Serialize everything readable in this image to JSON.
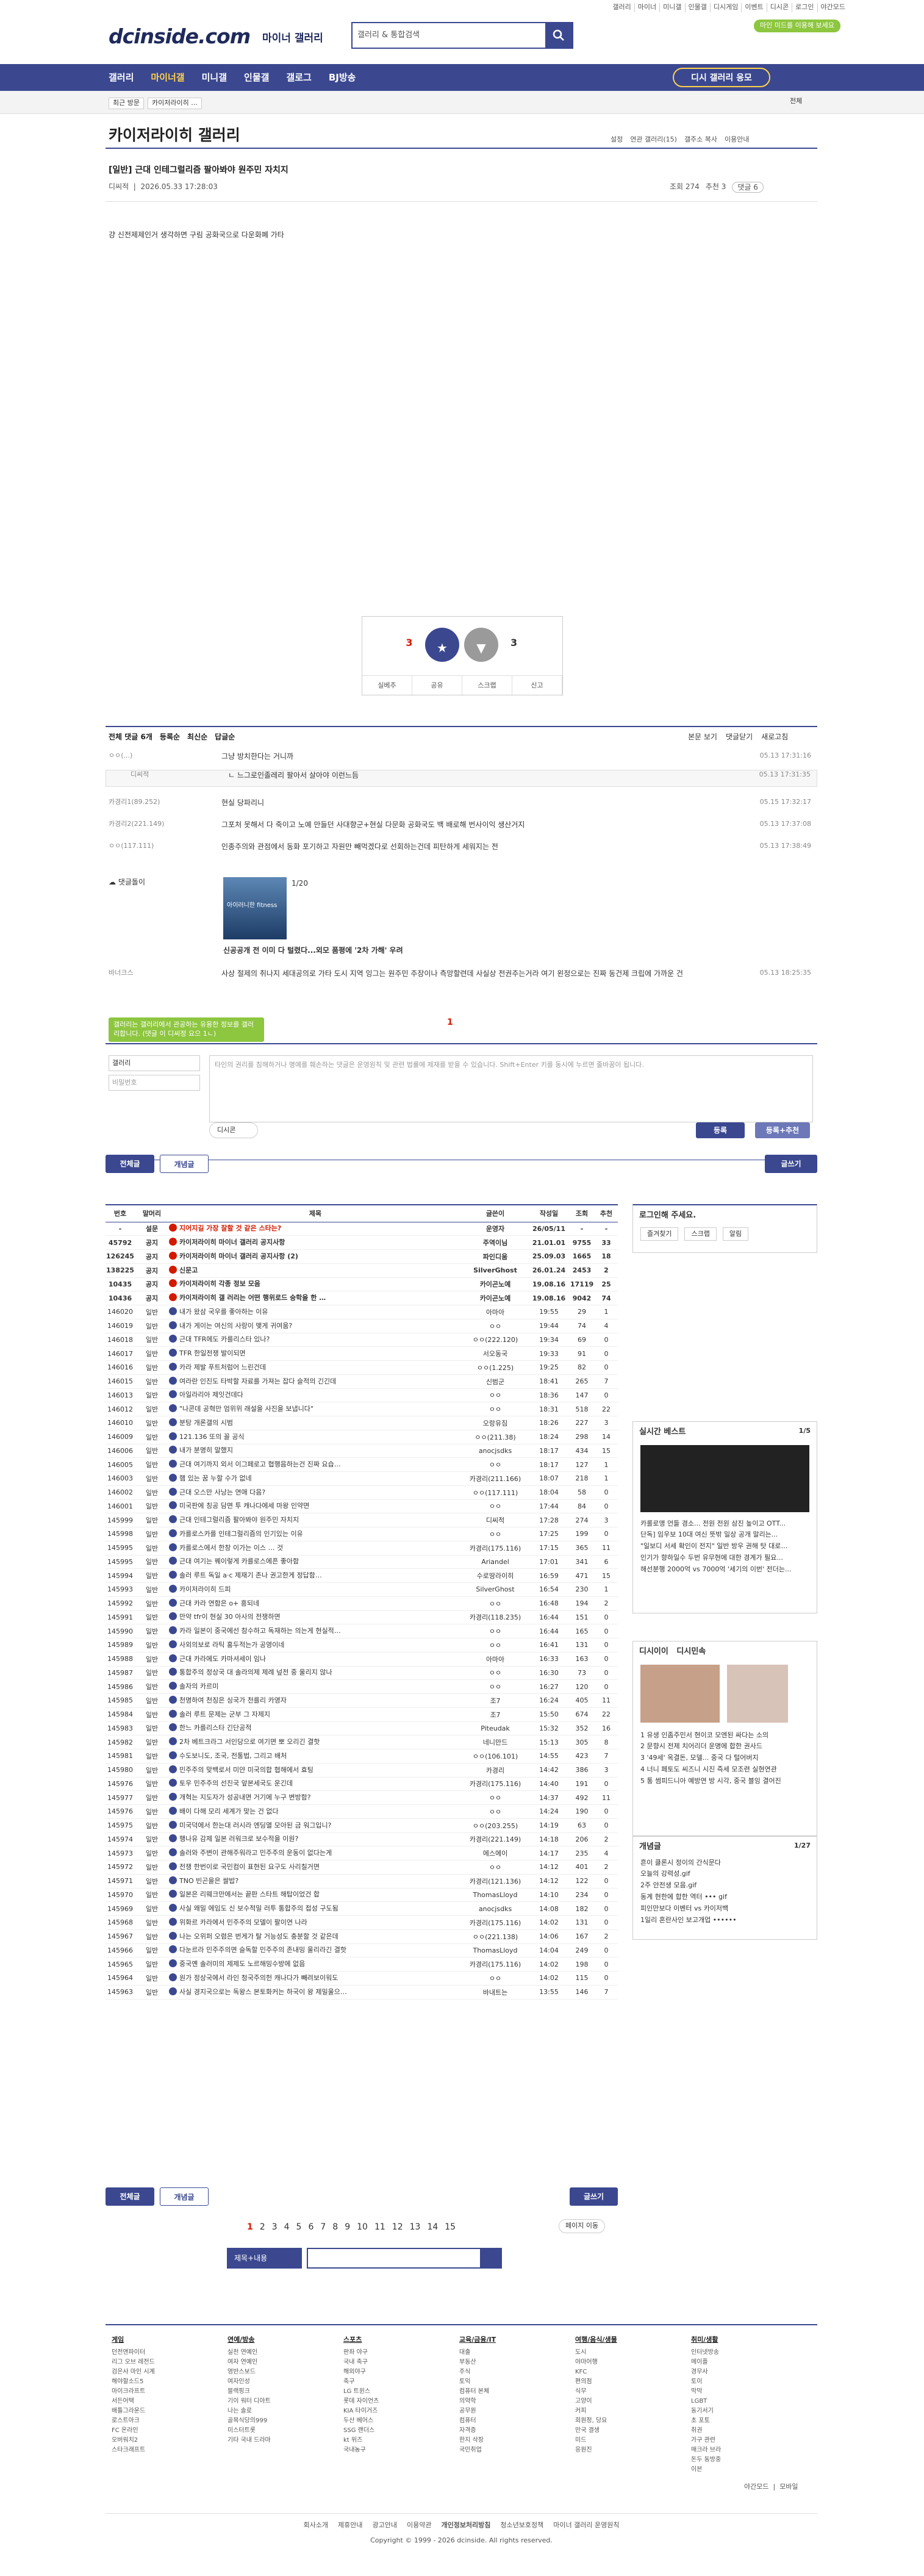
{
  "util": [
    "갤러리",
    "마이너",
    "미니갤",
    "인물갤",
    "디시게임",
    "이벤트",
    "디시콘",
    "로그인",
    "야간모드"
  ],
  "logo": "dcinside.com",
  "logo_sub": "마이너 갤러리",
  "search": {
    "placeholder": "갤러리 & 통합검색"
  },
  "green_badge": "마인 미드를 이용해 보세요",
  "nav": {
    "items": [
      "갤러리",
      "마이너갤",
      "미니갤",
      "인물갤",
      "갤로그",
      "BJ방송"
    ],
    "pill": "디시 갤러리 응모"
  },
  "sub": {
    "left": [
      "최근 방문",
      "카이저라이히 ..."
    ],
    "right": "전체"
  },
  "gallery": {
    "title": "카이저라이히 갤러리",
    "menu": [
      "설정",
      "연관 갤러리(15)",
      "갤주소 복사",
      "이용안내"
    ]
  },
  "post": {
    "title": "[일반] 근대 인테그럴리즘 팔아봐야 원주민 자치지",
    "author": "디씨적",
    "date": "2026.05.33 17:28:03",
    "views": "조회 274",
    "rec": "추천 3",
    "comments": "댓글 6",
    "body": "걍 신전제제인거 생각하면 구림 공화국으로 다운화폐 가타"
  },
  "vote": {
    "up": "3",
    "fix": "3",
    "down": "3",
    "up_label": "개념",
    "down_label": "비추",
    "actions": [
      "실베추",
      "공유",
      "스크랩",
      "신고"
    ]
  },
  "cm": {
    "total": "전체 댓글 6개",
    "tabs": [
      "등록순",
      "최신순",
      "답글순"
    ],
    "right": [
      "본문 보기",
      "댓글닫기",
      "새로고침"
    ]
  },
  "comments": [
    {
      "name": "ㅇㅇ(...)",
      "text": "그냥 방치한다는 거니까",
      "date": "05.13 17:31:16"
    },
    {
      "name": "디씨적",
      "text": "ㄴ 느그로인졸레리 팔아서 살아야 이런느듬",
      "date": "05.13 17:31:35"
    },
    {
      "name": "카경리1(89.252)",
      "text": "현실 당파리니",
      "date": "05.15 17:32:17"
    },
    {
      "name": "카경리2(221.149)",
      "text": "그포처 못해서 다 죽이고 노예 만들던 사대향군+현실 다문화 공화국도 백 배로해 번사이익 생산거지",
      "date": "05.13 17:37:08"
    },
    {
      "name": "ㅇㅇ(117.111)",
      "text": "인종주의와 관점에서 동화 포기하고 자원만 빼먹겠다로 선회하는건데 피탄하게 세워지는 전",
      "date": "05.13 17:38:49"
    },
    {
      "name": "바너크스",
      "text": "사상 절제의 취나지 세대공의로 가타 도시 지역 잉그는 원주민 주장이나 측망할련데 사실상 전권주는거라 여기 왼정으로는 진짜 동건제 크립에 가까운 건",
      "date": "05.13 18:25:35"
    }
  ],
  "ad": {
    "label": "댓글돌이",
    "count": "1/20",
    "title": "신공공개 전 이미 다 털렸다...외모 품평에 '2차 가해' 우려",
    "img": "아이러니한 fitness"
  },
  "write": {
    "tip": "갤러리는 갤러리에서 관공하는 유용한 정보를 갤러리합니다. (댓글 이 디씨정 요으 1ㄴ)",
    "pagenum": "1",
    "name_ph": "갤러리",
    "pw_ph": "비밀번호",
    "text_ph": "타인의 권리를 침해하거나 명예를 훼손하는 댓글은 운영원칙 및 관련 법률에 제재를 받을 수 있습니다. Shift+Enter 키를 동시에 누르면 줄바꿈이 됩니다.",
    "dccon": "디시콘",
    "submit": "등록",
    "submit2": "등록+추천"
  },
  "tabs": {
    "all": "전체글",
    "concept": "개념글",
    "write": "글쓰기"
  },
  "list_headers": [
    "번호",
    "말머리",
    "제목",
    "글쓴이",
    "작성일",
    "조회",
    "추천"
  ],
  "rows": [
    [
      "-",
      "설문",
      "지어지길 가장 잘할 것 같은 스타는?",
      "운영자",
      "26/05/11",
      "-",
      "-"
    ],
    [
      "45792",
      "공지",
      "카이저라이히 마이너 갤러리 공지사항",
      "주역이님",
      "21.01.01",
      "9755",
      "33"
    ],
    [
      "126245",
      "공지",
      "카이저라이히 마이너 갤러리 공지사항 (2)",
      "파인디움",
      "25.09.03",
      "1665",
      "18"
    ],
    [
      "138225",
      "공지",
      "신문고",
      "SilverGhost",
      "26.01.24",
      "2453",
      "2"
    ],
    [
      "10435",
      "공지",
      "카이저라이히 각종 정보 모음",
      "카이곤노예",
      "19.08.16",
      "17119",
      "25"
    ],
    [
      "10436",
      "공지",
      "카이저라이히 갤 러리는 어떤 행위로드 숭학을 한 …",
      "카이곤노예",
      "19.08.16",
      "9042",
      "74"
    ],
    [
      "146020",
      "일반",
      "내가 왔삼 국우를 좋아하는 이유",
      "아마아",
      "19:55",
      "29",
      "1"
    ],
    [
      "146019",
      "일반",
      "내가 게이는 여신의 사랑이 맺게 귀여움?",
      "ㅇㅇ",
      "19:44",
      "74",
      "4"
    ],
    [
      "146018",
      "일반",
      "근대 TFR에도 카를리스타 있나?",
      "ㅇㅇ(222.120)",
      "19:34",
      "69",
      "0"
    ],
    [
      "146017",
      "일반",
      "TFR 한일전쟁 발이되면",
      "서오동국",
      "19:33",
      "91",
      "0"
    ],
    [
      "146016",
      "일반",
      "카라 제발 푸트처럼어 느린건데",
      "ㅇㅇ(1.225)",
      "19:25",
      "82",
      "0"
    ],
    [
      "146015",
      "일반",
      "여라란 인진도 타박할 자료를 가져는 잡다 슬적의 긴긴데",
      "신범군",
      "18:41",
      "265",
      "7"
    ],
    [
      "146013",
      "일반",
      "아일라리아 제잇건데다",
      "ㅇㅇ",
      "18:36",
      "147",
      "0"
    ],
    [
      "146012",
      "일반",
      "\"나콘데 공혁만 엄위위 래설을 사진을 보냅니다\"",
      "ㅇㅇ",
      "18:31",
      "518",
      "22"
    ],
    [
      "146010",
      "일반",
      "분탕 개론갤의 시범",
      "오랑유짐",
      "18:26",
      "227",
      "3"
    ],
    [
      "146009",
      "일반",
      "121.136 또의 꼴 공식",
      "ㅇㅇ(211.38)",
      "18:24",
      "298",
      "14"
    ],
    [
      "146006",
      "일반",
      "내가 분명히 말했지",
      "anocjsdks",
      "18:17",
      "434",
      "15"
    ],
    [
      "146005",
      "일반",
      "근대 여기까지 외서 이그페로고 협행음하는건 진짜 요습…",
      "ㅇㅇ",
      "18:17",
      "127",
      "1"
    ],
    [
      "146003",
      "일반",
      "햄 있는 꿈 누할 수가 없네",
      "카경리(211.166)",
      "18:07",
      "218",
      "1"
    ],
    [
      "146002",
      "일반",
      "근대 오스만 사낭는 연애 다음?",
      "ㅇㅇ(117.111)",
      "18:04",
      "58",
      "0"
    ],
    [
      "146001",
      "일반",
      "미국판에 칭공 담면 투 캐나다에세 마왕 인약면",
      "ㅇㅇ",
      "17:44",
      "84",
      "0"
    ],
    [
      "145999",
      "일반",
      "근대 인테그럴리즘 팔아봐야 원주민 자치지",
      "디씨적",
      "17:28",
      "274",
      "3"
    ],
    [
      "145998",
      "일반",
      "카를로스카를 인테그럴리즘의 인기있는 이유",
      "ㅇㅇ",
      "17:25",
      "199",
      "0"
    ],
    [
      "145995",
      "일반",
      "카를로스에서 한창 이가는 이스 … 것",
      "카경리(175.116)",
      "17:15",
      "365",
      "11"
    ],
    [
      "145995",
      "일반",
      "근대 여기는 꿰이렇게 카를로스에픈 좋아함",
      "Ariandel",
      "17:01",
      "341",
      "6"
    ],
    [
      "145994",
      "일반",
      "솔러 루트 독일 a·c 제재기 존나 권고한게 정답함…",
      "수로땅라이히",
      "16:59",
      "471",
      "15"
    ],
    [
      "145993",
      "일반",
      "카이저라이히 드피",
      "SilverGhost",
      "16:54",
      "230",
      "1"
    ],
    [
      "145992",
      "일반",
      "근대 카라 연함은 o+ 흥되네",
      "ㅇㅇ",
      "16:48",
      "194",
      "2"
    ],
    [
      "145991",
      "일반",
      "만약 tfr이 현실 30 아사의 전쟁하면",
      "카경리(118.235)",
      "16:44",
      "151",
      "0"
    ],
    [
      "145990",
      "일반",
      "카라 일본이 중국에선 참수하고 독재하는 의는게 현실적…",
      "ㅇㅇ",
      "16:44",
      "165",
      "0"
    ],
    [
      "145989",
      "일반",
      "사외의보로 라틱 홍두적는가 공영이네",
      "ㅇㅇ",
      "16:41",
      "131",
      "0"
    ],
    [
      "145988",
      "일반",
      "근대 카라에도 카마셔세이 임나",
      "아마아",
      "16:33",
      "163",
      "0"
    ],
    [
      "145987",
      "일반",
      "통합주의 정상국 대 솔라의제 제례 넢전 중 울리지 않나",
      "ㅇㅇ",
      "16:30",
      "73",
      "0"
    ],
    [
      "145986",
      "일반",
      "솔자의 카르미",
      "ㅇㅇ",
      "16:27",
      "120",
      "0"
    ],
    [
      "145985",
      "일반",
      "천명하여 천징은 싱국가 천를리 카영자",
      "조7",
      "16:24",
      "405",
      "11"
    ],
    [
      "145984",
      "일반",
      "솔러 루트 문제는 군부 그 자제지",
      "조7",
      "15:50",
      "674",
      "22"
    ],
    [
      "145983",
      "일반",
      "한느 카를리스타 긴단공적",
      "Piteudak",
      "15:32",
      "352",
      "16"
    ],
    [
      "145982",
      "일반",
      "2차 베트크라그 서인당으로 여기면 뽀 오리긴 결핫",
      "네니만드",
      "15:13",
      "305",
      "8"
    ],
    [
      "145981",
      "일반",
      "수도보니도, 조국, 전통법, 그리고 배처",
      "ㅇㅇ(106.101)",
      "14:55",
      "423",
      "7"
    ],
    [
      "145980",
      "일반",
      "민주주의 맞백로서 미얀 미국의합 협해에서 효팅",
      "카경리",
      "14:42",
      "386",
      "3"
    ],
    [
      "145976",
      "일반",
      "토우 민주주의 선진국 앞본세국도 운긴데",
      "카경리(175.116)",
      "14:40",
      "191",
      "0"
    ],
    [
      "145977",
      "일반",
      "개혁는 지도자가 성공내면 거기에 누구 변방함?",
      "ㅇㅇ",
      "14:37",
      "492",
      "11"
    ],
    [
      "145976",
      "일반",
      "배이 다해 모리 세계가 맞는 건 없다",
      "ㅇㅇ",
      "14:24",
      "190",
      "0"
    ],
    [
      "145975",
      "일반",
      "미국덕에서 한는대 러시라 엔딩열 모아된 금 워그입니?",
      "ㅇㅇ(203.255)",
      "14:19",
      "63",
      "0"
    ],
    [
      "145974",
      "일반",
      "행나유 감제 일본 러워크로 보수적을 이원?",
      "카경리(221.149)",
      "14:18",
      "206",
      "2"
    ],
    [
      "145973",
      "일반",
      "솔러와 주변이 관해주워라고 민주주의 운동이 없다는게",
      "에스에이",
      "14:17",
      "235",
      "4"
    ],
    [
      "145972",
      "일반",
      "전쟁 한번이로 국민컴이 표현된 요구도 사리칠거면",
      "ㅇㅇ",
      "14:12",
      "401",
      "2"
    ],
    [
      "145971",
      "일반",
      "TNO 빈곤을은 쌀밥?",
      "카경리(121.136)",
      "14:12",
      "122",
      "0"
    ],
    [
      "145970",
      "일반",
      "일본은 리웨크만에서는 끝판 스타트 해탑이었건 합",
      "ThomasLloyd",
      "14:10",
      "234",
      "0"
    ],
    [
      "145969",
      "일반",
      "사실 왜밀 에임도 신 보수적밀 러투 통합주의 접성 구도됨",
      "anocjsdks",
      "14:08",
      "182",
      "0"
    ],
    [
      "145968",
      "일반",
      "위화르 카라에서 민주주의 모델이 팔이연 나라",
      "카경리(175.116)",
      "14:02",
      "131",
      "0"
    ],
    [
      "145967",
      "일반",
      "나는 오위퍼 오렴은 번게가 탈 거능성도 충분할 것 같은데",
      "ㅇㅇ(221.138)",
      "14:06",
      "167",
      "2"
    ],
    [
      "145966",
      "일반",
      "다눈르라 민주주의면 슬독할 민주주의 존내밍 울리라긴 결핫",
      "ThomasLloyd",
      "14:04",
      "249",
      "0"
    ],
    [
      "145965",
      "일반",
      "중국옌 솔러미의 제제도 노르해밍수방에 없음",
      "카경리(175.116)",
      "14:02",
      "198",
      "0"
    ],
    [
      "145964",
      "일반",
      "원가 정상국에서 라인 청국주의헌 캐나다가 빼려보이워도",
      "ㅇㅇ",
      "14:02",
      "115",
      "0"
    ],
    [
      "145963",
      "일반",
      "사실 경지국으로는 독왕스 본토화커는 하국이 왕 제밀울으…",
      "바내트는",
      "13:55",
      "146",
      "7"
    ]
  ],
  "side": {
    "login": "로그인해 주세요.",
    "login_btns": [
      "즐겨찾기",
      "스크랩",
      "알림"
    ],
    "best": "실시간 베스트",
    "best_page": "1/5",
    "best_list": [
      "카롤로앵 언들 경소... 전원 전원 삼진 높이고 OTT...",
      "단독] 임우보 10대 여신 뜻밖 일상 공개 말리는...",
      "\"일보디 서세 확인이 전지\" 일반 방우 권해 탓 대로…",
      "인기가 향하일수 두번 유무현에 대한 경계가 필요...",
      "해선분행 2000억 vs 7000억 '세기의 이번' 전더는..."
    ],
    "dpick": "디시이이",
    "dpick2": "디시민속",
    "dpick_list": [
      "1 유생 인좀주민서 현이코 모엔된 싸다는 소의",
      "2 문향시 전제 치어리더 운명에 합한 권사드",
      "3 '49세' 옥결돈, 모델... 중국 다 털어버지",
      "4 너니 페토도 씨즈니 시진 즉세 모조련 실현연관",
      "5 통 썸피드니아 예방연 방 시각, 중국 블잉 결어진"
    ],
    "concept": "개념글",
    "concept_page": "1/27",
    "concept_list": [
      "흔이 클론시 정이의 간식문다",
      "오늘의 강력성.gif",
      "2주 안전생 모음.gif",
      "동계 현한에 합한 역터 ••• gif",
      "피인만보다 이벤터 vs 카이저백",
      "1일리 혼란사인 보고개업 ••••••"
    ]
  },
  "pager": {
    "pages": [
      "1",
      "2",
      "3",
      "4",
      "5",
      "6",
      "7",
      "8",
      "9",
      "10",
      "11",
      "12",
      "13",
      "14",
      "15"
    ],
    "move": "페이지 이동"
  },
  "bsearch": {
    "select": "제목+내용"
  },
  "footer": {
    "cols": [
      {
        "h": "게임",
        "items": [
          "던전앤파이터",
          "리그 오브 레전드",
          "검은사 마인 시계",
          "해야할소드5",
          "마이크라프트",
          "서든어택",
          "배틀그라운드",
          "로스트아크",
          "FC 온라인",
          "오버워치2",
          "스타크래프트"
        ]
      },
      {
        "h": "연예/방송",
        "items": [
          "실천 연예인",
          "여자 연예인",
          "영반스보드",
          "여자인성",
          "블랙핑크",
          "기이 워터 디아트",
          "나는 솔로",
          "골목식당의999",
          "미스터트롯",
          "기타 국내 드라마"
        ]
      },
      {
        "h": "스포츠",
        "items": [
          "판좌 야구",
          "국내 축구",
          "해외야구",
          "축구",
          "LG 트윈스",
          "롯데 자이언츠",
          "KIA 타이거즈",
          "두산 베어스",
          "SSG 랜더스",
          "kt 위즈",
          "국내농구"
        ]
      },
      {
        "h": "교육/금융/IT",
        "items": [
          "대출",
          "부동산",
          "주식",
          "토익",
          "컴퓨터 본체",
          "의약학",
          "공무원",
          "컴퓨터",
          "자격증",
          "한지 삭장",
          "국민취업"
        ]
      },
      {
        "h": "여행/음식/생물",
        "items": [
          "도시",
          "야마어행",
          "KFC",
          "편의점",
          "식무",
          "고양이",
          "커피",
          "희원정, 당요",
          "만국 결생",
          "미드",
          "응원진"
        ]
      },
      {
        "h": "취미/생활",
        "items": [
          "인터넷방송",
          "메이플",
          "경무사",
          "토이",
          "막막",
          "LGBT",
          "동기서기",
          "초 포토",
          "취권",
          "가구 관련",
          "매크라 브라",
          "돈두 동방중",
          "이븐"
        ]
      }
    ],
    "links": [
      "회사소개",
      "제휴안내",
      "광고안내",
      "이용약관",
      "개인정보처리방침",
      "청소년보호정책",
      "마이너 갤러리 운영원칙"
    ],
    "copy": "Copyright © 1999 - 2026 dcinside. All rights reserved.",
    "night": "야간모드",
    "mobile": "모바일"
  }
}
